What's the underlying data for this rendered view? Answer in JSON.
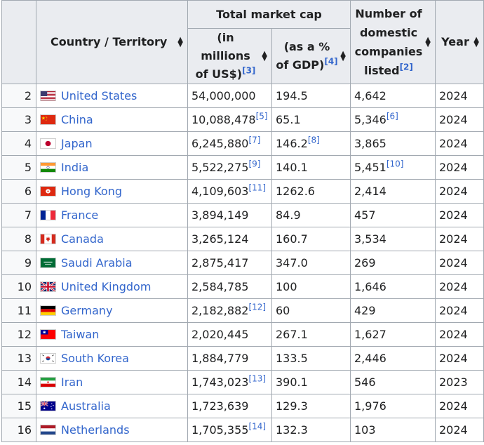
{
  "headers": {
    "country": "Country / Territory",
    "total_market_cap": "Total market cap",
    "millions_line1": "(in millions",
    "millions_line2": "of US$)",
    "millions_ref": "[3]",
    "gdp_line1": "(as a %",
    "gdp_line2": "of GDP)",
    "gdp_ref": "[4]",
    "companies_line1": "Number of",
    "companies_line2": "domestic",
    "companies_line3": "companies",
    "companies_line4": "listed",
    "companies_ref": "[2]",
    "year": "Year"
  },
  "sort_icon": "sort-arrows-icon",
  "rows": [
    {
      "rank": "2",
      "country": "United States",
      "flag": "us",
      "cap": "54,000,000",
      "cap_ref": "",
      "gdp": "194.5",
      "gdp_ref": "",
      "companies": "4,642",
      "companies_ref": "",
      "year": "2024"
    },
    {
      "rank": "3",
      "country": "China",
      "flag": "cn",
      "cap": "10,088,478",
      "cap_ref": "[5]",
      "gdp": "65.1",
      "gdp_ref": "",
      "companies": "5,346",
      "companies_ref": "[6]",
      "year": "2024"
    },
    {
      "rank": "4",
      "country": "Japan",
      "flag": "jp",
      "cap": "6,245,880",
      "cap_ref": "[7]",
      "gdp": "146.2",
      "gdp_ref": "[8]",
      "companies": "3,865",
      "companies_ref": "",
      "year": "2024"
    },
    {
      "rank": "5",
      "country": "India",
      "flag": "in",
      "cap": "5,522,275",
      "cap_ref": "[9]",
      "gdp": "140.1",
      "gdp_ref": "",
      "companies": "5,451",
      "companies_ref": "[10]",
      "year": "2024"
    },
    {
      "rank": "6",
      "country": "Hong Kong",
      "flag": "hk",
      "cap": "4,109,603",
      "cap_ref": "[11]",
      "gdp": "1262.6",
      "gdp_ref": "",
      "companies": "2,414",
      "companies_ref": "",
      "year": "2024"
    },
    {
      "rank": "7",
      "country": "France",
      "flag": "fr",
      "cap": "3,894,149",
      "cap_ref": "",
      "gdp": "84.9",
      "gdp_ref": "",
      "companies": "457",
      "companies_ref": "",
      "year": "2024"
    },
    {
      "rank": "8",
      "country": "Canada",
      "flag": "ca",
      "cap": "3,265,124",
      "cap_ref": "",
      "gdp": "160.7",
      "gdp_ref": "",
      "companies": "3,534",
      "companies_ref": "",
      "year": "2024"
    },
    {
      "rank": "9",
      "country": "Saudi Arabia",
      "flag": "sa",
      "cap": "2,875,417",
      "cap_ref": "",
      "gdp": "347.0",
      "gdp_ref": "",
      "companies": "269",
      "companies_ref": "",
      "year": "2024"
    },
    {
      "rank": "10",
      "country": "United Kingdom",
      "flag": "gb",
      "cap": "2,584,785",
      "cap_ref": "",
      "gdp": "100",
      "gdp_ref": "",
      "companies": "1,646",
      "companies_ref": "",
      "year": "2024"
    },
    {
      "rank": "11",
      "country": "Germany",
      "flag": "de",
      "cap": "2,182,882",
      "cap_ref": "[12]",
      "gdp": "60",
      "gdp_ref": "",
      "companies": "429",
      "companies_ref": "",
      "year": "2024"
    },
    {
      "rank": "12",
      "country": "Taiwan",
      "flag": "tw",
      "cap": "2,020,445",
      "cap_ref": "",
      "gdp": "267.1",
      "gdp_ref": "",
      "companies": "1,627",
      "companies_ref": "",
      "year": "2024"
    },
    {
      "rank": "13",
      "country": "South Korea",
      "flag": "kr",
      "cap": "1,884,779",
      "cap_ref": "",
      "gdp": "133.5",
      "gdp_ref": "",
      "companies": "2,446",
      "companies_ref": "",
      "year": "2024"
    },
    {
      "rank": "14",
      "country": "Iran",
      "flag": "ir",
      "cap": "1,743,023",
      "cap_ref": "[13]",
      "gdp": "390.1",
      "gdp_ref": "",
      "companies": "546",
      "companies_ref": "",
      "year": "2023"
    },
    {
      "rank": "15",
      "country": "Australia",
      "flag": "au",
      "cap": "1,723,639",
      "cap_ref": "",
      "gdp": "129.3",
      "gdp_ref": "",
      "companies": "1,976",
      "companies_ref": "",
      "year": "2024"
    },
    {
      "rank": "16",
      "country": "Netherlands",
      "flag": "nl",
      "cap": "1,705,355",
      "cap_ref": "[14]",
      "gdp": "132.3",
      "gdp_ref": "",
      "companies": "103",
      "companies_ref": "",
      "year": "2024"
    }
  ]
}
